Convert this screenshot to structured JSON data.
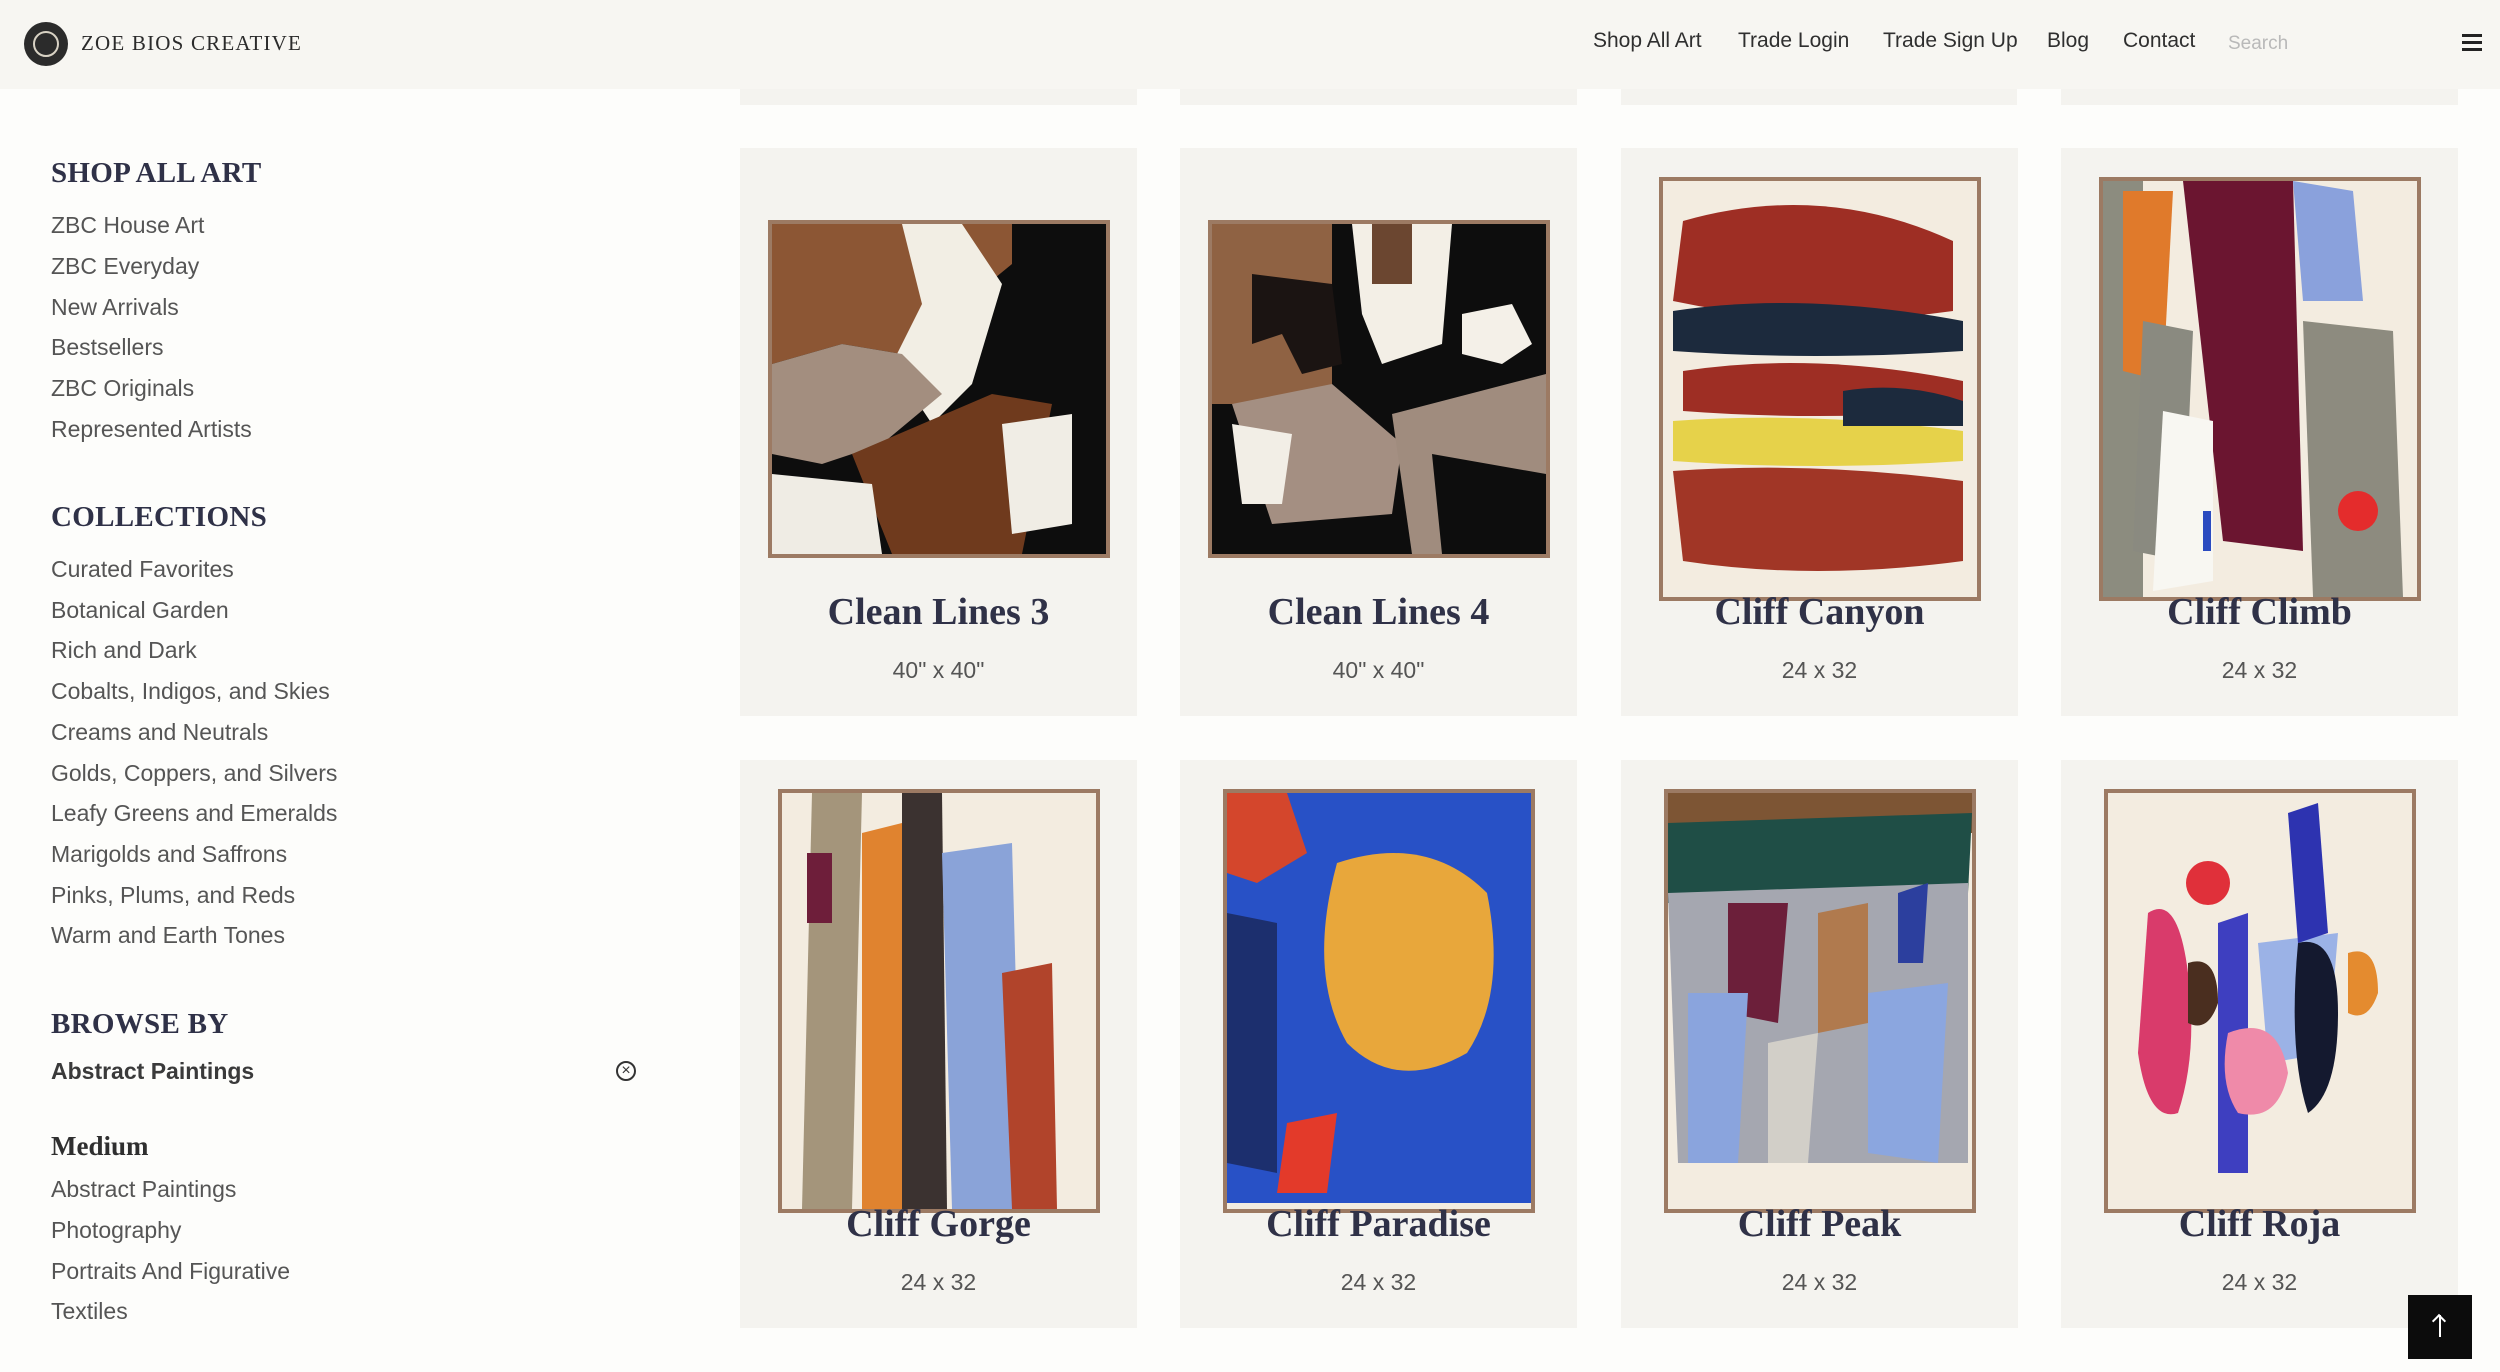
{
  "brand": {
    "name": "ZOE BIOS CREATIVE"
  },
  "nav": {
    "items": [
      "Shop All Art",
      "Trade Login",
      "Trade Sign Up",
      "Blog",
      "Contact"
    ],
    "search_placeholder": "Search"
  },
  "sidebar": {
    "shop": {
      "heading": "SHOP ALL ART",
      "links": [
        "ZBC House Art",
        "ZBC Everyday",
        "New Arrivals",
        "Bestsellers",
        "ZBC Originals",
        "Represented Artists"
      ]
    },
    "collections": {
      "heading": "COLLECTIONS",
      "links": [
        "Curated Favorites",
        "Botanical Garden",
        "Rich and Dark",
        "Cobalts, Indigos, and Skies",
        "Creams and Neutrals",
        "Golds, Coppers, and Silvers",
        "Leafy Greens and Emeralds",
        "Marigolds and Saffrons",
        "Pinks, Plums, and Reds",
        "Warm and Earth Tones"
      ]
    },
    "browse": {
      "heading": "BROWSE BY",
      "active_filter": "Abstract Paintings"
    },
    "medium": {
      "heading": "Medium",
      "links": [
        "Abstract Paintings",
        "Photography",
        "Portraits And Figurative",
        "Textiles"
      ]
    }
  },
  "products": [
    {
      "title": "Clean Lines 3",
      "size": "40\" x 40\""
    },
    {
      "title": "Clean Lines 4",
      "size": "40\" x 40\""
    },
    {
      "title": "Cliff Canyon",
      "size": "24 x 32"
    },
    {
      "title": "Cliff Climb",
      "size": "24 x 32"
    },
    {
      "title": "Cliff Gorge",
      "size": "24 x 32"
    },
    {
      "title": "Cliff Paradise",
      "size": "24 x 32"
    },
    {
      "title": "Cliff Peak",
      "size": "24 x 32"
    },
    {
      "title": "Cliff Roja",
      "size": "24 x 32"
    }
  ],
  "colors": {
    "header_bg": "#f7f6f2",
    "card_bg": "#f4f3ef",
    "heading": "#2f3147",
    "frame": "#9c7a63"
  }
}
